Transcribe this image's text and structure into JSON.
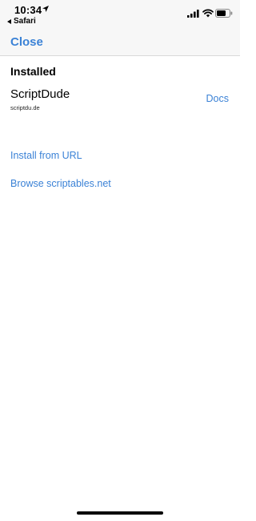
{
  "status_bar": {
    "time": "10:34",
    "back_app": "Safari",
    "icons": [
      "location-arrow-icon",
      "signal-icon",
      "wifi-icon",
      "battery-icon"
    ]
  },
  "nav": {
    "close_label": "Close"
  },
  "installed": {
    "title": "Installed",
    "items": [
      {
        "name": "ScriptDude",
        "domain": "scriptdu.de",
        "docs_label": "Docs"
      }
    ]
  },
  "actions": {
    "install_from_url": "Install from URL",
    "browse": "Browse scriptables.net"
  },
  "colors": {
    "accent": "#3b82d6",
    "bar_background": "#f7f7f7"
  }
}
